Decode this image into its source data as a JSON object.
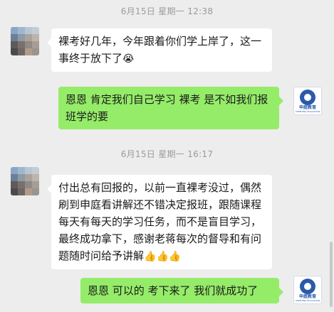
{
  "timestamps": [
    "6月15日 星期一 12:38",
    "6月15日 星期一 16:17"
  ],
  "messages": [
    {
      "side": "in",
      "text": "裸考好几年，今年跟着你们学上岸了，这一事终于放下了",
      "emoji": "😭"
    },
    {
      "side": "out",
      "text": "恩恩 肯定我们自己学习 裸考 是不如我们报班学的要"
    },
    {
      "side": "in",
      "text": "付出总有回报的，以前一直裸考没过，偶然刷到申庭看讲解还不错决定报班，跟随课程每天有每天的学习任务，而不是盲目学习，最终成功拿下，感谢老蒋每次的督导和有问题随时问给予讲解",
      "emoji": "👍👍👍"
    },
    {
      "side": "out",
      "text": "恩恩 可以的 考下来了 我们就成功了"
    }
  ],
  "brand": {
    "name": "申庭教育",
    "sub": "SHENTING EDUCATION"
  },
  "colors": {
    "background": "#ededed",
    "bubble_in": "#ffffff",
    "bubble_out": "#95ec69",
    "brand_blue": "#2b5aa8"
  }
}
